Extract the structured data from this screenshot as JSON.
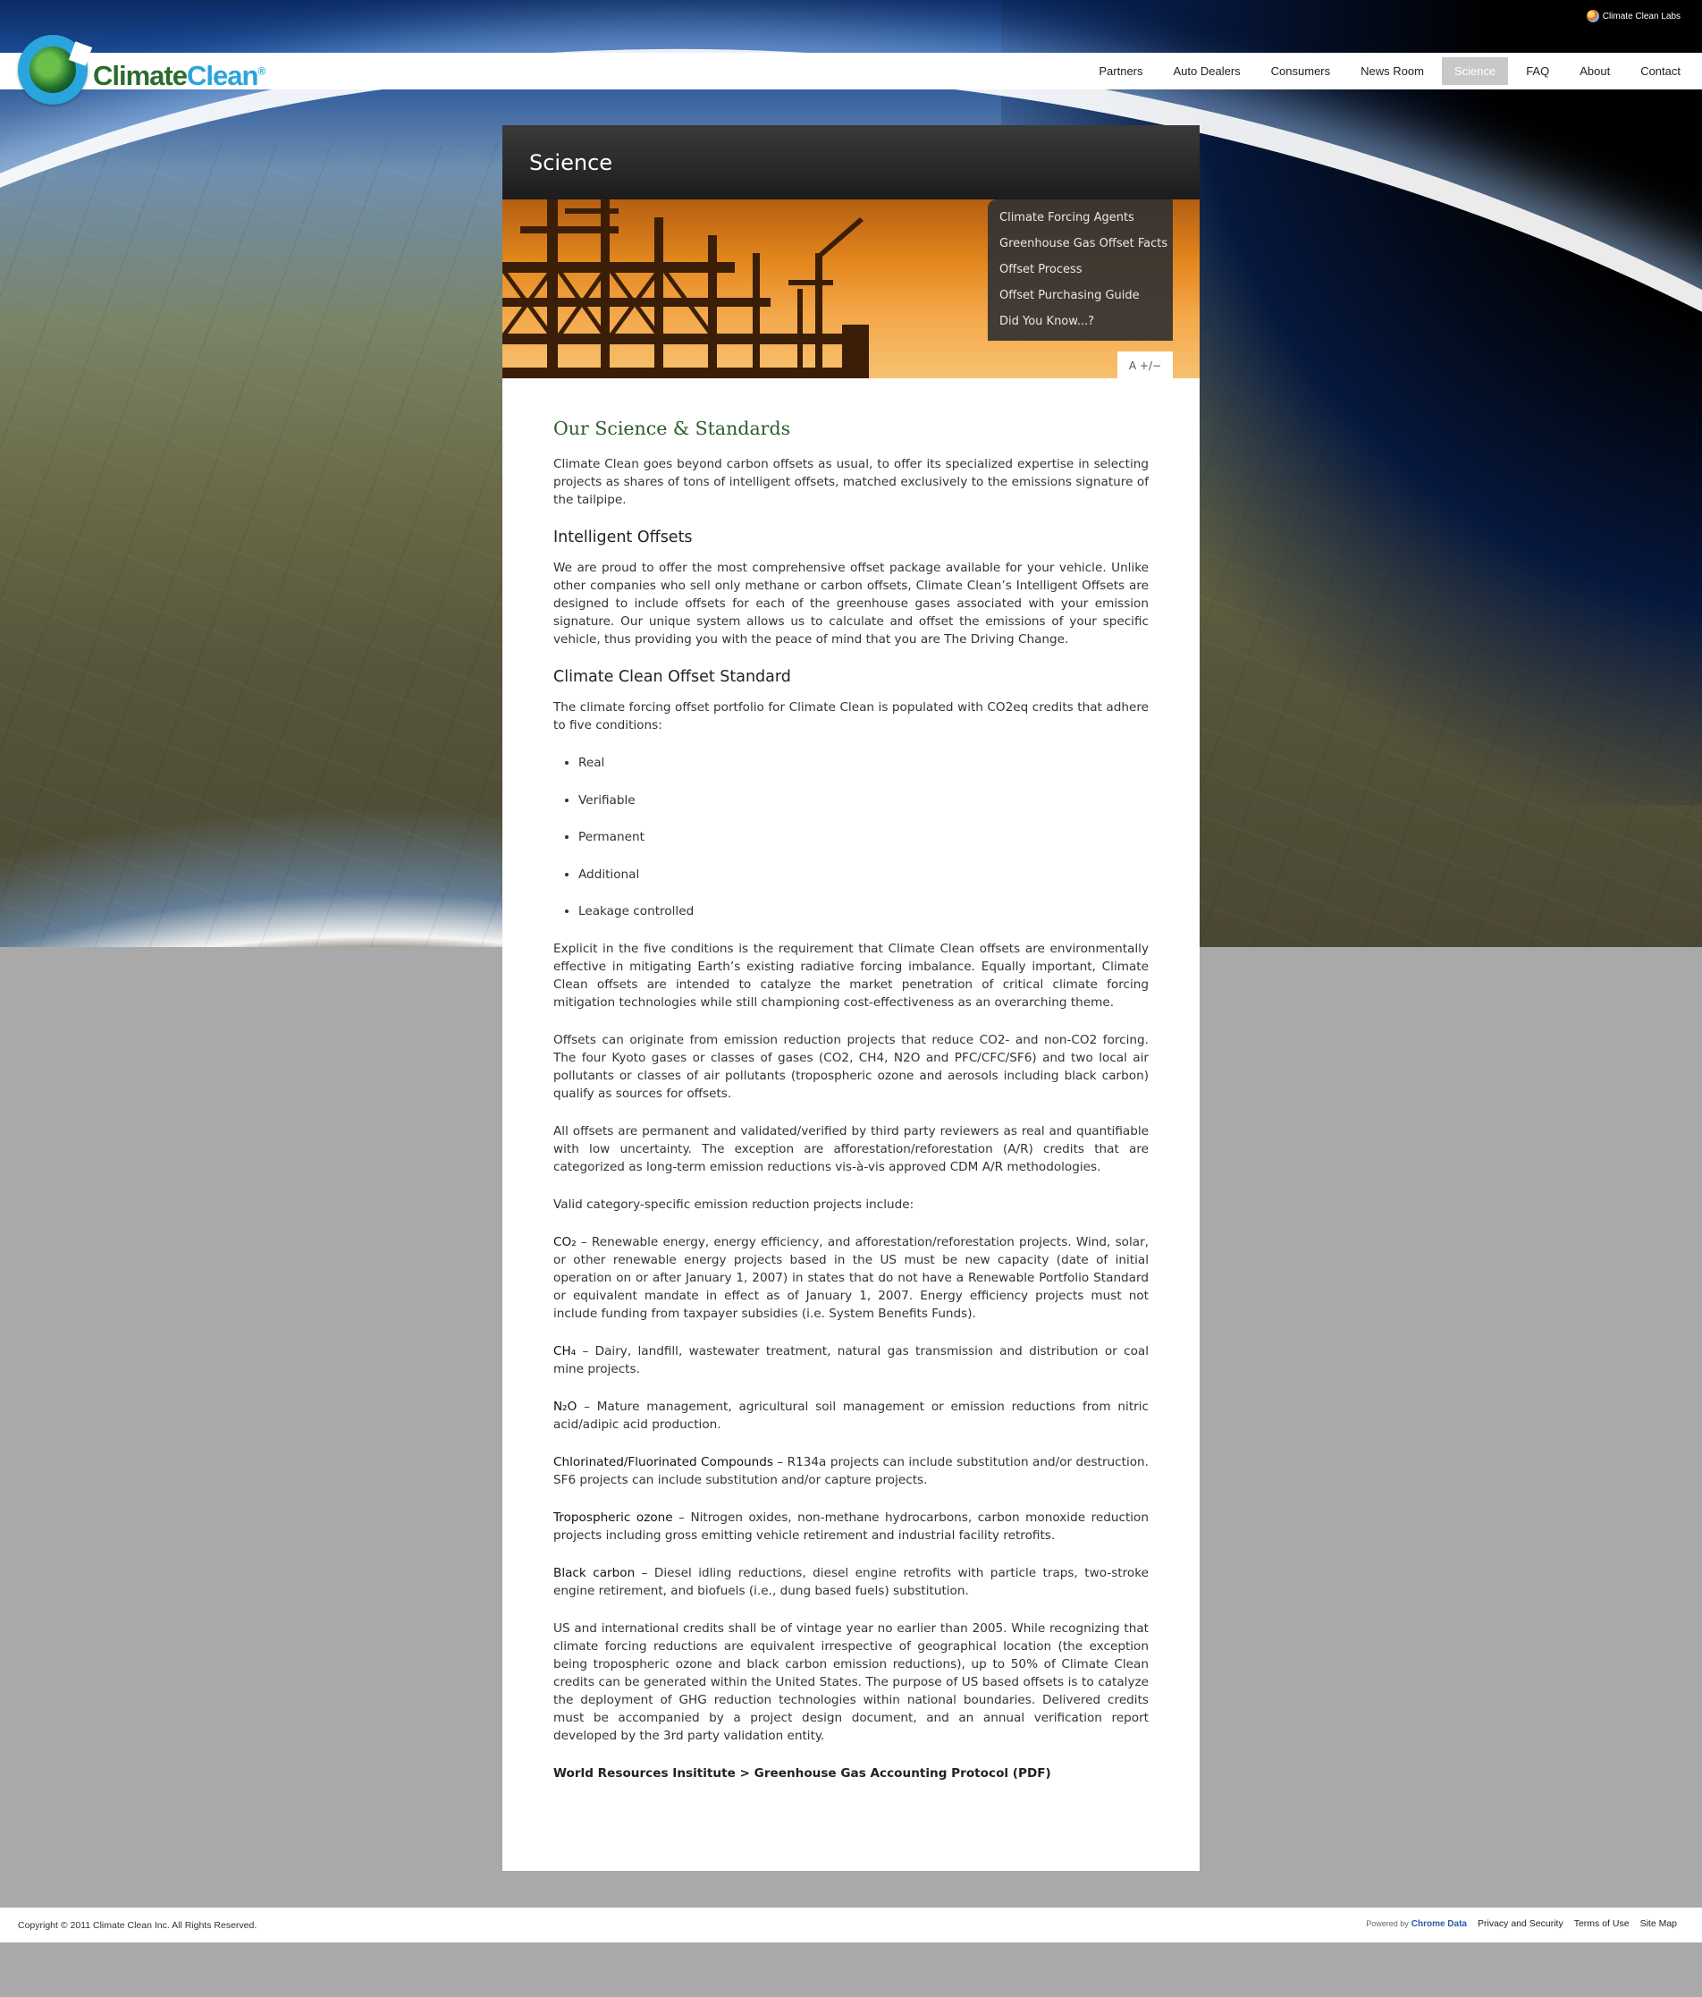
{
  "top": {
    "labs_link": "Climate Clean Labs"
  },
  "brand": {
    "name_part1": "Climate",
    "name_part2": "Clean",
    "mark": "®"
  },
  "nav": {
    "items": [
      "Partners",
      "Auto Dealers",
      "Consumers",
      "News Room",
      "Science",
      "FAQ",
      "About",
      "Contact"
    ],
    "active": "Science"
  },
  "section": {
    "title": "Science",
    "submenu": [
      "Climate Forcing Agents",
      "Greenhouse Gas Offset Facts",
      "Offset Process",
      "Offset Purchasing Guide",
      "Did You Know...?"
    ],
    "font_control": "A +/−"
  },
  "article": {
    "heading": "Our Science & Standards",
    "intro": "Climate Clean goes beyond carbon offsets as usual, to offer its specialized expertise in selecting projects as shares of tons of intelligent offsets, matched exclusively to the emissions signature of the tailpipe.",
    "h_intelligent": "Intelligent Offsets",
    "p_intelligent": "We are proud to offer the most comprehensive offset package available for your vehicle. Unlike other companies who sell only methane or carbon offsets, Climate Clean’s Intelligent Offsets are designed to include offsets for each of the greenhouse gases associated with your emission signature. Our unique system allows us to calculate and offset the emissions of your specific vehicle, thus providing you with the peace of mind that you are The Driving Change.",
    "h_standard": "Climate Clean Offset Standard",
    "p_standard": "The climate forcing offset portfolio for Climate Clean is populated with CO2eq credits that adhere to five conditions:",
    "conditions": [
      "Real",
      "Verifiable",
      "Permanent",
      "Additional",
      "Leakage controlled"
    ],
    "p_explicit": "Explicit in the five conditions is the requirement that Climate Clean offsets are environmentally effective in mitigating Earth’s existing radiative forcing imbalance. Equally important, Climate Clean offsets are intended to catalyze the market penetration of critical climate forcing mitigation technologies while still championing cost-effectiveness as an overarching theme.",
    "p_originate": "Offsets can originate from emission reduction projects that reduce CO2- and non-CO2 forcing. The four Kyoto gases or classes of gases (CO2, CH4, N2O and PFC/CFC/SF6) and two local air pollutants or classes of air pollutants (tropospheric ozone and aerosols including black carbon) qualify as sources for offsets.",
    "p_permanent": "All offsets are permanent and validated/verified by third party reviewers as real and quantifiable with low uncertainty. The exception are afforestation/reforestation (A/R) credits that are categorized as long-term emission reductions vis-à-vis approved CDM A/R methodologies.",
    "p_valid": "Valid category-specific emission reduction projects include:",
    "cat_co2_label": "CO₂",
    "cat_co2_text": " – Renewable energy, energy efficiency, and afforestation/reforestation projects. Wind, solar, or other renewable energy projects based in the US must be new capacity (date of initial operation on or after January 1, 2007) in states that do not have a Renewable Portfolio Standard or equivalent mandate in effect as of January 1, 2007. Energy efficiency projects must not include funding from taxpayer subsidies (i.e. System Benefits Funds).",
    "cat_ch4_label": "CH₄",
    "cat_ch4_text": " – Dairy, landfill, wastewater treatment, natural gas transmission and distribution or coal mine projects.",
    "cat_n2o_label": "N₂O",
    "cat_n2o_text": " – Mature management, agricultural soil management or emission reductions from nitric acid/adipic acid production.",
    "cat_cfc_label": "Chlorinated/Fluorinated Compounds",
    "cat_cfc_text": " – R134a projects can include substitution and/or destruction. SF6 projects can include substitution and/or capture projects.",
    "cat_ozone_label": "Tropospheric ozone",
    "cat_ozone_text": " – Nitrogen oxides, non-methane hydrocarbons, carbon monoxide reduction projects including gross emitting vehicle retirement and industrial facility retrofits.",
    "cat_bc_label": "Black carbon",
    "cat_bc_text": " – Diesel idling reductions, diesel engine retrofits with particle traps, two-stroke engine retirement, and biofuels (i.e., dung based fuels) substitution.",
    "p_vintage": "US and international credits shall be of vintage year no earlier than 2005. While recognizing that climate forcing reductions are equivalent irrespective of geographical location (the exception being tropospheric ozone and black carbon emission reductions), up to 50% of Climate Clean credits can be generated within the United States. The purpose of US based offsets is to catalyze the deployment of GHG reduction technologies within national boundaries. Delivered credits must be accompanied by a project design document, and an annual verification report developed by the 3rd party validation entity.",
    "wri_link": "World Resources Insititute > Greenhouse Gas Accounting Protocol (PDF)"
  },
  "footer": {
    "copyright": "Copyright © 2011 Climate Clean Inc. All Rights Reserved.",
    "powered_by": "Powered by",
    "powered_brand": "Chrome Data",
    "links": [
      "Privacy and Security",
      "Terms of Use",
      "Site Map"
    ]
  }
}
